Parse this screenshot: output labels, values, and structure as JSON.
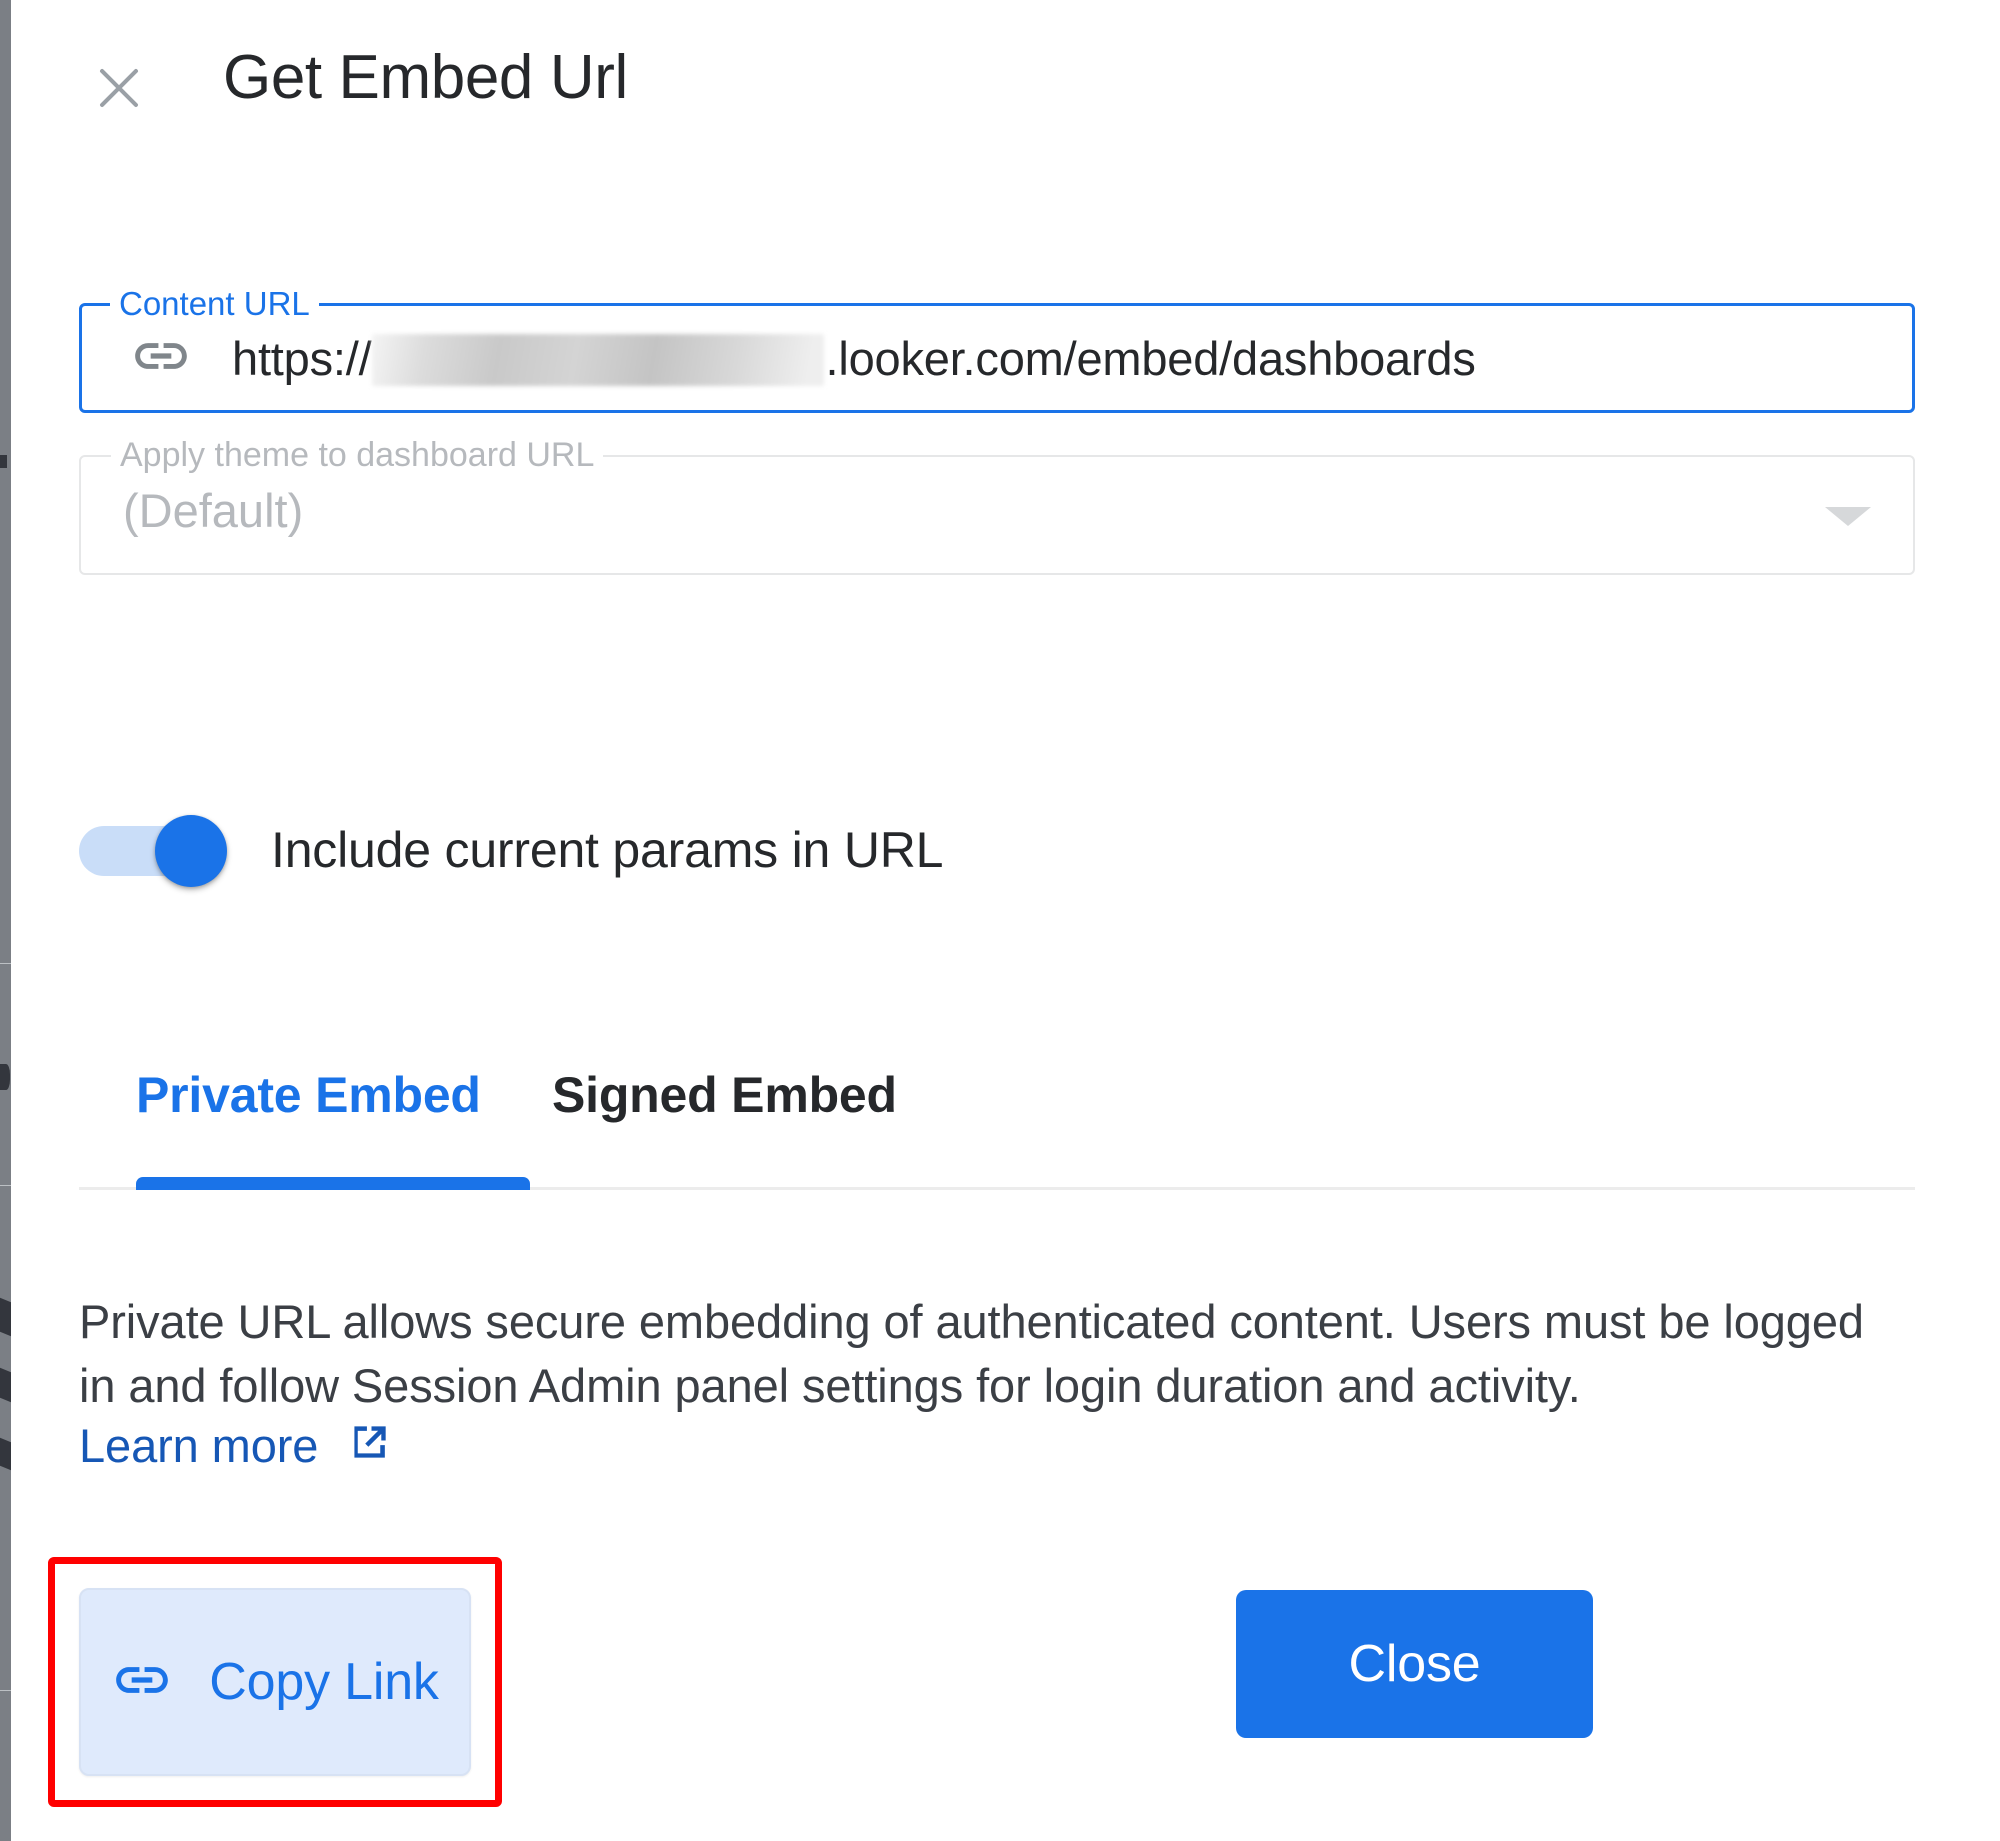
{
  "dialog": {
    "title": "Get Embed Url",
    "close_icon": "close-icon"
  },
  "content_url": {
    "legend": "Content URL",
    "icon": "link-icon",
    "prefix": "https://",
    "redacted": "",
    "suffix": ".looker.com/embed/dashboards",
    "focused": true
  },
  "theme_select": {
    "legend": "Apply theme to dashboard URL",
    "value": "(Default)",
    "caret_icon": "chevron-down-icon",
    "disabled": true
  },
  "params_toggle": {
    "label": "Include current params in URL",
    "state": "on"
  },
  "tabs": {
    "items": [
      {
        "label": "Private Embed",
        "active": true
      },
      {
        "label": "Signed Embed",
        "active": false
      }
    ]
  },
  "description": {
    "text": "Private URL allows secure embedding of authenticated content. Users must be logged in and follow Session Admin panel settings for login duration and activity.",
    "learn_more": "Learn more",
    "learn_more_icon": "external-link-icon"
  },
  "footer": {
    "copy_label": "Copy Link",
    "copy_icon": "link-icon",
    "close_label": "Close"
  },
  "colors": {
    "accent_blue": "#1a73e8",
    "link_blue": "#1657b5",
    "toggle_track": "#c9ddf8",
    "copy_bg": "#dfeafc",
    "highlight_red": "#ff0000",
    "text_dark": "#26282b",
    "text_muted": "#b6b9bd"
  }
}
